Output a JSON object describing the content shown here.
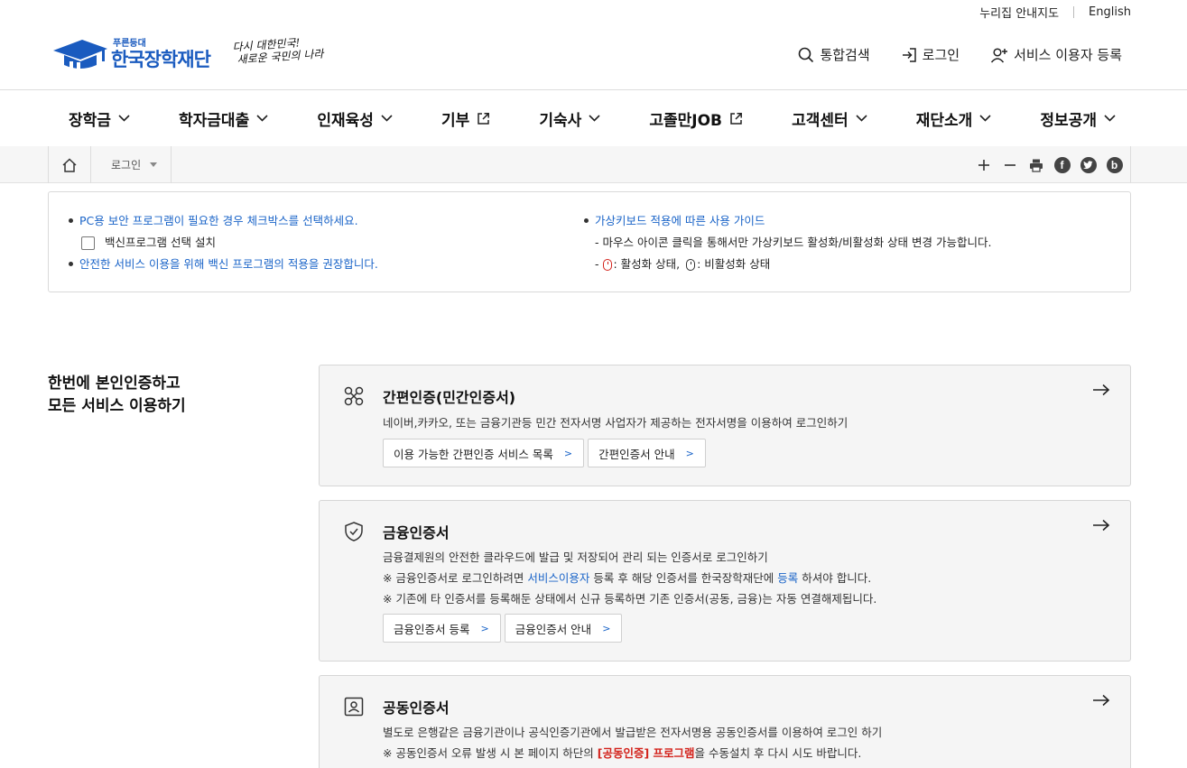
{
  "util": {
    "sitemap": "누리집 안내지도",
    "english": "English"
  },
  "logo": {
    "small": "푸른등대",
    "name": "한국장학재단",
    "slogan_line1": "다시 대한민국!",
    "slogan_line2": "새로운 국민의 나라"
  },
  "header": {
    "search": "통합검색",
    "login": "로그인",
    "register": "서비스 이용자 등록"
  },
  "nav": [
    {
      "label": "장학금",
      "icon": "chevron-down-icon"
    },
    {
      "label": "학자금대출",
      "icon": "chevron-down-icon"
    },
    {
      "label": "인재육성",
      "icon": "chevron-down-icon"
    },
    {
      "label": "기부",
      "icon": "external-link-icon"
    },
    {
      "label": "기숙사",
      "icon": "chevron-down-icon"
    },
    {
      "label": "고졸만JOB",
      "icon": "external-link-icon"
    },
    {
      "label": "고객센터",
      "icon": "chevron-down-icon"
    },
    {
      "label": "재단소개",
      "icon": "chevron-down-icon"
    },
    {
      "label": "정보공개",
      "icon": "chevron-down-icon"
    }
  ],
  "breadcrumb": {
    "current": "로그인"
  },
  "tools": {
    "facebook": "f",
    "blog": "b"
  },
  "notice": {
    "left1": "PC용 보안 프로그램이 필요한 경우 체크박스를 선택하세요.",
    "checkbox_label": "백신프로그램 선택 설치",
    "left2": "안전한 서비스 이용을 위해 백신 프로그램의 적용을 권장합니다.",
    "right1": "가상키보드 적용에 따른 사용 가이드",
    "right2": "- 마우스 아이콘 클릭을 통해서만 가상키보드 활성화/비활성화 상태 변경 가능합니다.",
    "right3_dash": "-",
    "right3_active": ": 활성화 상태,",
    "right3_inactive": ": 비활성화 상태"
  },
  "section": {
    "line1": "한번에 본인인증하고",
    "line2": "모든 서비스 이용하기"
  },
  "cards": [
    {
      "title": "간편인증(민간인증서)",
      "desc": "네이버,카카오, 또는 금융기관등 민간 전자서명 사업자가 제공하는 전자서명을 이용하여 로그인하기",
      "btn1": "이용 가능한 간편인증 서비스 목록",
      "btn2": "간편인증서 안내"
    },
    {
      "title": "금융인증서",
      "desc1": "금융결제원의 안전한 클라우드에 발급 및 저장되어 관리 되는 인증서로 로그인하기",
      "desc2_a": "※ 금융인증서로 로그인하려면 ",
      "desc2_link1": "서비스이용자",
      "desc2_b": " 등록 후 해당 인증서를 한국장학재단에 ",
      "desc2_link2": "등록",
      "desc2_c": " 하셔야 합니다.",
      "desc3": "※ 기존에 타 인증서를 등록해둔 상태에서 신규 등록하면 기존 인증서(공동, 금융)는 자동 연결해제됩니다.",
      "btn1": "금융인증서 등록",
      "btn2": "금융인증서 안내"
    },
    {
      "title": "공동인증서",
      "desc1": "별도로 은행같은 금융기관이나 공식인증기관에서 발급받은 전자서명용 공동인증서를 이용하여 로그인 하기",
      "desc2_a": "※ 공동인증서 오류 발생 시 본 페이지 하단의 ",
      "desc2_red": "[공동인증] 프로그램",
      "desc2_b": "을 수동설치 후 다시 시도 바랍니다."
    }
  ],
  "btn_arrow": ">",
  "colors": {
    "brand": "#1a5bbf",
    "link": "#1a64c8",
    "alert": "#d3231c"
  }
}
